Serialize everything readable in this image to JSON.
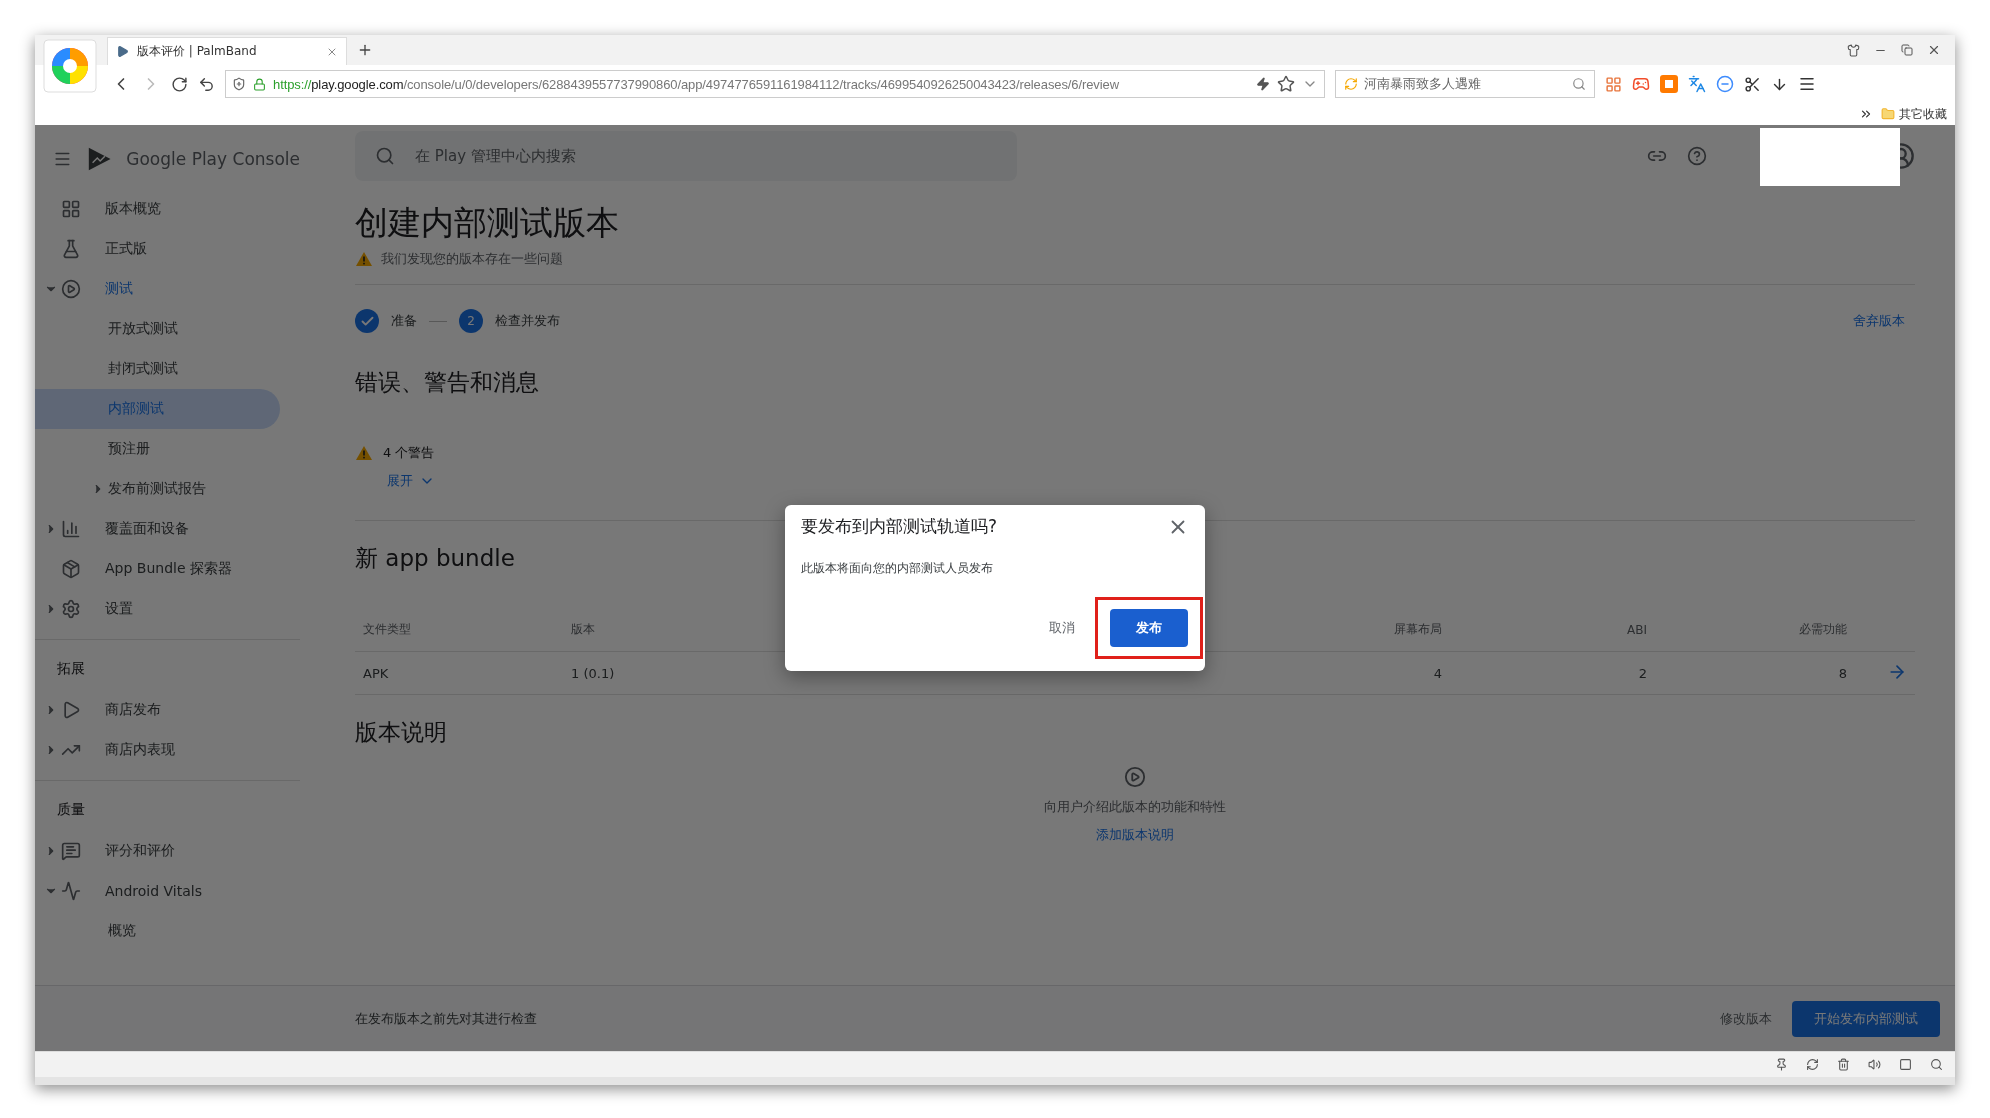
{
  "browser": {
    "tab": {
      "title": "版本评价 | PalmBand"
    },
    "url": {
      "scheme": "https://",
      "host": "play.google.com",
      "path": "/console/u/0/developers/6288439557737990860/app/4974776591161984112/tracks/4699540926250043423/releases/6/review"
    },
    "search": {
      "value": "河南暴雨致多人遇难"
    },
    "bookmark": "其它收藏"
  },
  "app": {
    "brand": "Google Play Console",
    "search_placeholder": "在 Play 管理中心内搜索"
  },
  "sidebar": [
    {
      "items": [
        {
          "label": "版本概览",
          "selected": false
        },
        {
          "label": "正式版",
          "selected": false
        },
        {
          "label": "测试",
          "selected": false,
          "expanded": true,
          "children": [
            {
              "label": "开放式测试",
              "selected": false
            },
            {
              "label": "封闭式测试",
              "selected": false
            },
            {
              "label": "内部测试",
              "selected": true
            },
            {
              "label": "预注册",
              "selected": false
            },
            {
              "label": "发布前测试报告",
              "selected": false,
              "expanded": false
            }
          ]
        },
        {
          "label": "覆盖面和设备",
          "selected": false,
          "expanded": false
        },
        {
          "label": "App Bundle 探索器",
          "selected": false
        },
        {
          "label": "设置",
          "selected": false,
          "expanded": false
        }
      ]
    },
    {
      "title": "拓展",
      "items": [
        {
          "label": "商店发布",
          "selected": false,
          "expanded": false
        },
        {
          "label": "商店内表现",
          "selected": false,
          "expanded": false
        }
      ]
    },
    {
      "title": "质量",
      "items": [
        {
          "label": "评分和评价",
          "selected": false,
          "expanded": false
        },
        {
          "label": "Android Vitals",
          "selected": false,
          "expanded": true,
          "children": [
            {
              "label": "概览",
              "selected": false
            }
          ]
        }
      ]
    }
  ],
  "page": {
    "title": "创建内部测试版本",
    "warning": "我们发现您的版本存在一些问题",
    "steps": [
      {
        "label": "准备",
        "done": true
      },
      {
        "label": "检查并发布",
        "number": "2",
        "done": false
      }
    ],
    "discard": "舍弃版本",
    "issues": {
      "heading": "错误、警告和消息",
      "count": "4 个警告",
      "expand": "展开"
    },
    "bundle": {
      "heading": "新 app bundle",
      "columns": [
        "文件类型",
        "版本",
        "屏幕布局",
        "ABI",
        "必需功能"
      ],
      "rows": [
        [
          "APK",
          "1 (0.1)",
          "4",
          "2",
          "8"
        ]
      ]
    },
    "notes": {
      "heading": "版本说明",
      "empty": "向用户介绍此版本的功能和特性",
      "add": "添加版本说明"
    }
  },
  "footer": {
    "hint": "在发布版本之前先对其进行检查",
    "edit": "修改版本",
    "start": "开始发布内部测试"
  },
  "dialog": {
    "title": "要发布到内部测试轨道吗?",
    "body": "此版本将面向您的内部测试人员发布",
    "cancel": "取消",
    "confirm": "发布",
    "confirm_highlighted": true
  }
}
